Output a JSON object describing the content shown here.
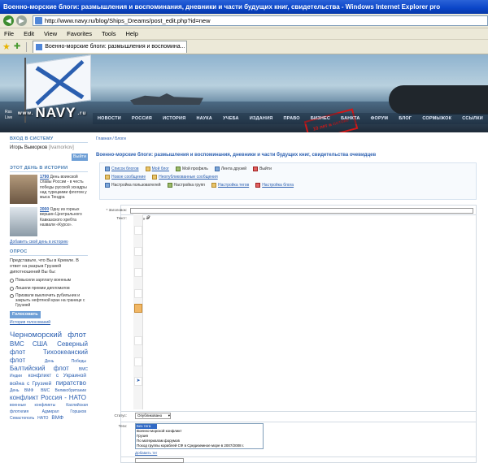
{
  "browser": {
    "window_title": "Военно-морские блоги: размышления и воспоминания, дневники и части будущих книг, свидетельства  - Windows Internet Explorer pro",
    "url": "http://www.navy.ru/blog/Ships_Dreams/post_edit.php?id=new",
    "menu": [
      "File",
      "Edit",
      "View",
      "Favorites",
      "Tools",
      "Help"
    ],
    "tab_title": "Военно-морские блоги: размышления и воспомина..."
  },
  "banner": {
    "logo": "NAVY",
    "logo_prefix": "www.",
    "logo_suffix": ".ru",
    "rss": "Rss Live",
    "stamp": "10 лет в потоке",
    "nav": [
      "НОВОСТИ",
      "РОССИЯ",
      "ИСТОРИЯ",
      "НАУКА",
      "УЧЕБА",
      "ИЗДАНИЯ",
      "ПРАВО",
      "БИЗНЕС",
      "БАНКТА",
      "ФОРУМ",
      "БЛОГ",
      "СОРМЫЖОК",
      "ССЫЛКИ"
    ]
  },
  "login": {
    "heading": "ВХОД В СИСТЕМУ",
    "user_name": "Игорь Выморков",
    "user_handle": "[Ivamorkov]",
    "exit_button": "Выйти"
  },
  "history": {
    "heading": "ЭТОТ ДЕНЬ В ИСТОРИИ",
    "items": [
      {
        "year": "1790",
        "text": "День воинской славы России - в честь победы русской эскадры над турецкими флотом у мыса Тендра"
      },
      {
        "year": "2000",
        "text": "Одну из горных вершин Центрального Кавказского хребта назвали «Курск»."
      }
    ],
    "add_link": "Добавить свой день в историю"
  },
  "poll": {
    "heading": "ОПРОС",
    "question": "Представьте, что Вы в Кремле. В ответ на разрыв Грузией дипотношений Вы бы:",
    "options": [
      "Повысили зарплату военным",
      "Лишили премии дипломатов",
      "Призвали выключить рубильник и закрыть нефтяной кран на границе с Грузией"
    ],
    "vote_button": "Голосовать",
    "history_link": "История голосований"
  },
  "tags": {
    "items": [
      {
        "t": "Черноморский флот",
        "s": "xl"
      },
      {
        "t": "ВМС США",
        "s": "l"
      },
      {
        "t": "Северный флот",
        "s": "l"
      },
      {
        "t": "Тихоокеанский флот",
        "s": "l"
      },
      {
        "t": "День Победы",
        "s": "s"
      },
      {
        "t": "Балтийский флот",
        "s": "l"
      },
      {
        "t": "ВМС Индии",
        "s": "s"
      },
      {
        "t": "конфликт с Украиной",
        "s": "m"
      },
      {
        "t": "война с Грузией",
        "s": "m"
      },
      {
        "t": "пиратство",
        "s": "l"
      },
      {
        "t": "День ВМФ",
        "s": "s"
      },
      {
        "t": "ВМС Великобритании",
        "s": "s"
      },
      {
        "t": "конфликт Россия - НАТО",
        "s": "l"
      },
      {
        "t": "военные конфликты",
        "s": "s"
      },
      {
        "t": "Каспийская флотилия",
        "s": "s"
      },
      {
        "t": "Адмирал Горшков",
        "s": "s"
      },
      {
        "t": "Севастополь",
        "s": "s"
      },
      {
        "t": "НАТО",
        "s": "s"
      },
      {
        "t": "ВМФ",
        "s": "m"
      }
    ]
  },
  "main": {
    "breadcrumb": "Главная / Блоги",
    "page_title": "Военно-морские блоги: размышления и воспоминания, дневники и части будущих книг, свидетельства очевидцев",
    "toolbar_row1": [
      "Список блогов",
      "Мой блог",
      "Мой профиль",
      "Лента друзей",
      "Выйти"
    ],
    "toolbar_row2": [
      "Новое сообщение",
      "Неопубликованные сообщения"
    ],
    "toolbar_row3": [
      "Настройка пользователей",
      "Настройка групп",
      "Настройка тегов",
      "Настройка блога"
    ]
  },
  "form": {
    "title_label": "* Заголовок:",
    "text_label": "Текст:",
    "status_label": "Статус:",
    "status_value": "Опубликовано",
    "tags_label": "Теги:",
    "tag_options": [
      "Без тега",
      "Военно-морской конфликт",
      "Грузия",
      "По материалам форумов",
      "Поход группы кораблей СФ в Средиземное море в 2007/2008 г."
    ],
    "add_tag_link": "Добавить тег"
  }
}
